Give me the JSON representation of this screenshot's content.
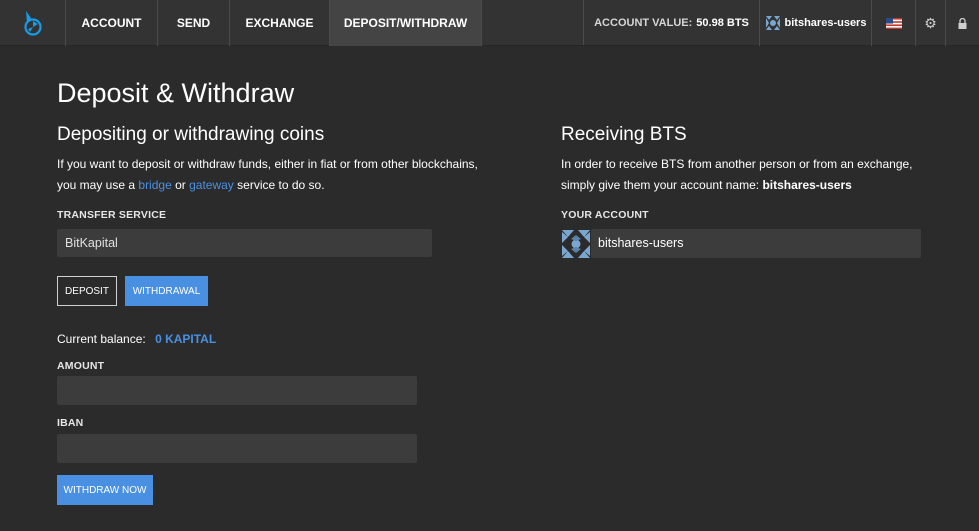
{
  "nav": {
    "items": [
      "ACCOUNT",
      "SEND",
      "EXCHANGE",
      "DEPOSIT/WITHDRAW"
    ],
    "account_value_label": "ACCOUNT VALUE:",
    "account_value": "50.98 BTS",
    "username": "bitshares-users"
  },
  "page": {
    "title": "Deposit & Withdraw"
  },
  "left": {
    "title": "Depositing or withdrawing coins",
    "desc_line1": "If you want to deposit or withdraw funds, either in fiat or from other blockchains,",
    "desc_line2_pre": "you may use a",
    "bridge_link": "bridge",
    "desc_or": "or",
    "gateway_link": "gateway",
    "desc_line2_post": "service to do so.",
    "transfer_label": "TRANSFER SERVICE",
    "transfer_value": "BitKapital",
    "deposit_button": "DEPOSIT",
    "withdrawal_button": "WITHDRAWAL",
    "balance_label": "Current balance:",
    "balance_value": "0 KAPITAL",
    "amount_label": "AMOUNT",
    "iban_label": "IBAN",
    "withdraw_button": "WITHDRAW NOW"
  },
  "right": {
    "title": "Receiving BTS",
    "desc_line1": "In order to receive BTS from another person or from an exchange,",
    "desc_line2_pre": "simply give them your account name:",
    "account_name_bold": "bitshares-users",
    "your_account_label": "YOUR ACCOUNT",
    "account_value": "bitshares-users"
  },
  "colors": {
    "accent": "#4a90e2",
    "background": "#2b2b2b",
    "nav": "#333333",
    "field": "#3c3c3c"
  },
  "icons": [
    "bitshares-logo-icon",
    "identicon-avatar-icon",
    "us-flag-icon",
    "gear-icon",
    "lock-icon"
  ]
}
